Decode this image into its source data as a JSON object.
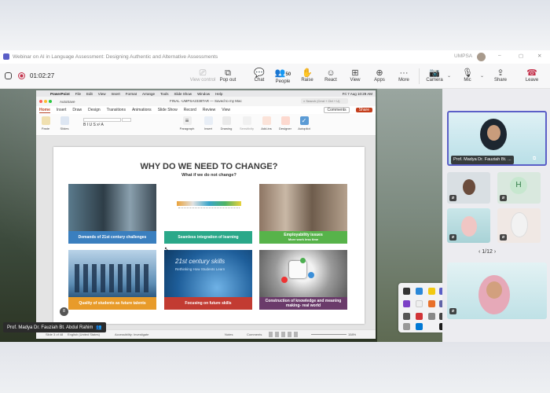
{
  "window": {
    "title": "Webinar on AI in Language Assessment: Designing Authentic and Alternative Assessments",
    "org": "UMPSA"
  },
  "meeting": {
    "timer": "01:02:27",
    "participants_count": "50",
    "controls": {
      "view_control": "View control",
      "pop_out": "Pop out",
      "chat": "Chat",
      "people": "People",
      "raise": "Raise",
      "react": "React",
      "view": "View",
      "apps": "Apps",
      "more": "More",
      "camera": "Camera",
      "mic": "Mic",
      "share": "Share",
      "leave": "Leave"
    }
  },
  "powerpoint": {
    "app_menu": [
      "PowerPoint",
      "File",
      "Edit",
      "View",
      "Insert",
      "Format",
      "Arrange",
      "Tools",
      "Slide Show",
      "Window",
      "Help"
    ],
    "clock": "Fri 7 Aug 10:29 AM",
    "file_name": "FINAL -UMPSA2338TAR",
    "saved_status": "Saved to my Mac",
    "autosave": "AutoSave",
    "search_placeholder": "Search (Cmd + Ctrl + U)",
    "ribbon_tabs": [
      "Home",
      "Insert",
      "Draw",
      "Design",
      "Transitions",
      "Animations",
      "Slide Show",
      "Record",
      "Review",
      "View"
    ],
    "active_tab": "Home",
    "comments_label": "Comments",
    "share_label": "Share",
    "ribbon_buttons": [
      "Paste",
      "Slides",
      "Paragraph",
      "Insert",
      "Drawing",
      "Sensitivity",
      "Add-ins",
      "Designer",
      "Autopilot"
    ],
    "status": {
      "slide": "Slide 3 of 48",
      "language": "English (United States)",
      "accessibility": "Accessibility: Investigate",
      "notes": "Notes",
      "comments": "Comments",
      "zoom": "158%"
    }
  },
  "slide": {
    "title": "WHY DO WE NEED TO CHANGE?",
    "subtitle": "What if we do not change?",
    "cells": [
      {
        "caption": "Demands of 21st century challenges",
        "color": "#3a7fbf"
      },
      {
        "caption": "Seamless integration of learning",
        "color": "#2aa889"
      },
      {
        "caption": "Employability issues",
        "caption2": "More work less time",
        "color": "#57b34a"
      },
      {
        "caption": "Quality of students as  future talents",
        "color": "#e89b2a"
      },
      {
        "caption": "Focusing on future skills",
        "color": "#c23b32"
      },
      {
        "caption": "Construction  of knowledge and meaning making- real world",
        "color": "#6a3b6a"
      }
    ],
    "image_text": {
      "skills_title": "21st century skills",
      "skills_sub": "Rethinking How Students Learn"
    }
  },
  "speaker": {
    "name_tag": "Prof. Madya Dr. Fauziah Bt. Abdul Rahim",
    "tile_label": "Prof. Madya Dr. Fauziah Bt. ..."
  },
  "gallery": {
    "avatar_letter": "H",
    "pager": "1/12"
  }
}
